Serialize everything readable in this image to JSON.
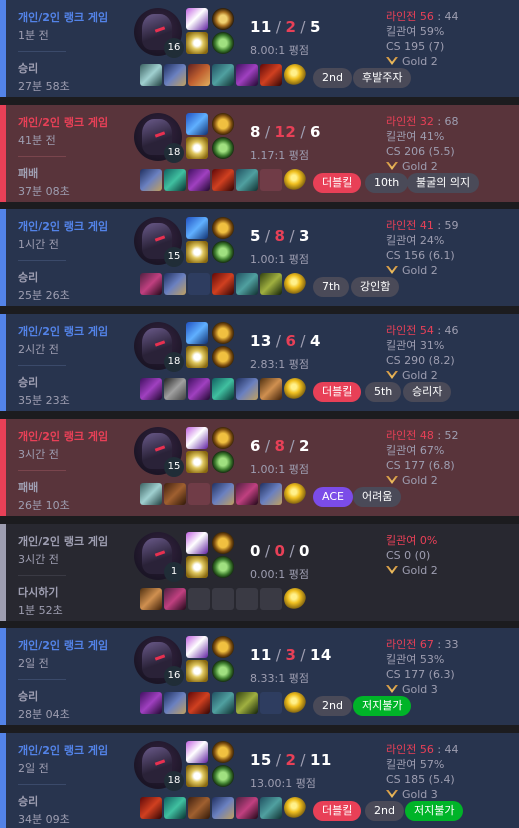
{
  "matches": [
    {
      "status": "win",
      "queue": "개인/2인 랭크 게임",
      "ago": "1분 전",
      "result": "승리",
      "duration": "27분 58초",
      "level": "16",
      "kills": "11",
      "deaths": "2",
      "assists": "5",
      "ratio": "8.00:1 평점",
      "lane": "라인전 56",
      "lane_score": "44",
      "kp": "킬관여 59%",
      "cs": "CS 195 (7)",
      "tier": "Gold 2",
      "spells": [
        "cleanse",
        "flash"
      ],
      "runes": [
        "key",
        "resolve"
      ],
      "items": [
        "c1",
        "c2",
        "c3",
        "c4",
        "c5",
        "c6"
      ],
      "badges": [
        {
          "label": "2nd",
          "style": "gray"
        },
        {
          "label": "후발주자",
          "style": "gray"
        }
      ]
    },
    {
      "status": "loss",
      "queue": "개인/2인 랭크 게임",
      "ago": "41분 전",
      "result": "패배",
      "duration": "37분 08초",
      "level": "18",
      "kills": "8",
      "deaths": "12",
      "assists": "6",
      "ratio": "1.17:1 평점",
      "lane": "라인전 32",
      "lane_score": "68",
      "kp": "킬관여 41%",
      "cs": "CS 206 (5.5)",
      "tier": "Gold 2",
      "spells": [
        "ghost",
        "flash"
      ],
      "runes": [
        "prec",
        "resolve"
      ],
      "items": [
        "c2",
        "c8",
        "c5",
        "c6",
        "c4",
        "empty"
      ],
      "badges": [
        {
          "label": "더블킬",
          "style": "red"
        },
        {
          "label": "10th",
          "style": "gray"
        },
        {
          "label": "불굴의 의지",
          "style": "gray"
        }
      ]
    },
    {
      "status": "win",
      "queue": "개인/2인 랭크 게임",
      "ago": "1시간 전",
      "result": "승리",
      "duration": "25분 26초",
      "level": "15",
      "kills": "5",
      "deaths": "8",
      "assists": "3",
      "ratio": "1.00:1 평점",
      "lane": "라인전 41",
      "lane_score": "59",
      "kp": "킬관여 24%",
      "cs": "CS 156 (6.1)",
      "tier": "Gold 2",
      "spells": [
        "ghost",
        "flash"
      ],
      "runes": [
        "prec",
        "resolve"
      ],
      "items": [
        "c10",
        "c2",
        "empty",
        "c6",
        "c4",
        "c11"
      ],
      "badges": [
        {
          "label": "7th",
          "style": "gray"
        },
        {
          "label": "강인함",
          "style": "gray"
        }
      ]
    },
    {
      "status": "win",
      "queue": "개인/2인 랭크 게임",
      "ago": "2시간 전",
      "result": "승리",
      "duration": "35분 23초",
      "level": "18",
      "kills": "13",
      "deaths": "6",
      "assists": "4",
      "ratio": "2.83:1 평점",
      "lane": "라인전 54",
      "lane_score": "46",
      "kp": "킬관여 31%",
      "cs": "CS 290 (8.2)",
      "tier": "Gold 2",
      "spells": [
        "ghost",
        "flash"
      ],
      "runes": [
        "prec",
        "prec"
      ],
      "items": [
        "c5",
        "c9",
        "c5",
        "c8",
        "c2",
        "c12"
      ],
      "badges": [
        {
          "label": "더블킬",
          "style": "red"
        },
        {
          "label": "5th",
          "style": "gray"
        },
        {
          "label": "승리자",
          "style": "gray"
        }
      ]
    },
    {
      "status": "loss",
      "queue": "개인/2인 랭크 게임",
      "ago": "3시간 전",
      "result": "패배",
      "duration": "26분 10초",
      "level": "15",
      "kills": "6",
      "deaths": "8",
      "assists": "2",
      "ratio": "1.00:1 평점",
      "lane": "라인전 48",
      "lane_score": "52",
      "kp": "킬관여 67%",
      "cs": "CS 177 (6.8)",
      "tier": "Gold 2",
      "spells": [
        "cleanse",
        "flash"
      ],
      "runes": [
        "prec",
        "resolve"
      ],
      "items": [
        "c1",
        "c7",
        "empty",
        "c2",
        "c10",
        "c2"
      ],
      "badges": [
        {
          "label": "ACE",
          "style": "purple"
        },
        {
          "label": "어려움",
          "style": "gray"
        }
      ]
    },
    {
      "status": "remake",
      "queue": "개인/2인 랭크 게임",
      "ago": "3시간 전",
      "result": "다시하기",
      "duration": "1분 52초",
      "level": "1",
      "kills": "0",
      "deaths": "0",
      "assists": "0",
      "ratio": "0.00:1 평점",
      "lane": "",
      "lane_score": "",
      "kp": "킬관여 0%",
      "cs": "CS 0 (0)",
      "tier": "Gold 2",
      "spells": [
        "cleanse",
        "flash"
      ],
      "runes": [
        "prec",
        "resolve"
      ],
      "items": [
        "c12",
        "c10",
        "empty",
        "empty",
        "empty",
        "empty"
      ],
      "badges": []
    },
    {
      "status": "win",
      "queue": "개인/2인 랭크 게임",
      "ago": "2일 전",
      "result": "승리",
      "duration": "28분 04초",
      "level": "16",
      "kills": "11",
      "deaths": "3",
      "assists": "14",
      "ratio": "8.33:1 평점",
      "lane": "라인전 67",
      "lane_score": "33",
      "kp": "킬관여 53%",
      "cs": "CS 177 (6.3)",
      "tier": "Gold 3",
      "spells": [
        "cleanse",
        "flash"
      ],
      "runes": [
        "prec",
        "resolve"
      ],
      "items": [
        "c5",
        "c2",
        "c6",
        "c4",
        "c11",
        "empty"
      ],
      "badges": [
        {
          "label": "2nd",
          "style": "gray"
        },
        {
          "label": "저지불가",
          "style": "green"
        }
      ]
    },
    {
      "status": "win",
      "queue": "개인/2인 랭크 게임",
      "ago": "2일 전",
      "result": "승리",
      "duration": "34분 09초",
      "level": "18",
      "kills": "15",
      "deaths": "2",
      "assists": "11",
      "ratio": "13.00:1 평점",
      "lane": "라인전 56",
      "lane_score": "44",
      "kp": "킬관여 57%",
      "cs": "CS 185 (5.4)",
      "tier": "Gold 3",
      "spells": [
        "cleanse",
        "flash"
      ],
      "runes": [
        "prec",
        "resolve"
      ],
      "items": [
        "c6",
        "c8",
        "c7",
        "c2",
        "c10",
        "c4"
      ],
      "badges": [
        {
          "label": "더블킬",
          "style": "red"
        },
        {
          "label": "2nd",
          "style": "gray"
        },
        {
          "label": "저지불가",
          "style": "green"
        }
      ]
    }
  ],
  "spell_classes": {
    "cleanse": "sp-cleanse",
    "flash": "sp-flash",
    "ghost": "sp-ghost",
    "ignite": "sp-ignite",
    "heal": "sp-heal"
  },
  "rune_classes": {
    "key": "rn-key",
    "resolve": "rn-resolve",
    "prec": "rn-prec"
  },
  "colors": {
    "win": "#5383e8",
    "loss": "#e84057",
    "remake": "#9e9eb1",
    "win_bg": "#28344e",
    "loss_bg": "#59343b",
    "remake_bg": "#282830"
  }
}
